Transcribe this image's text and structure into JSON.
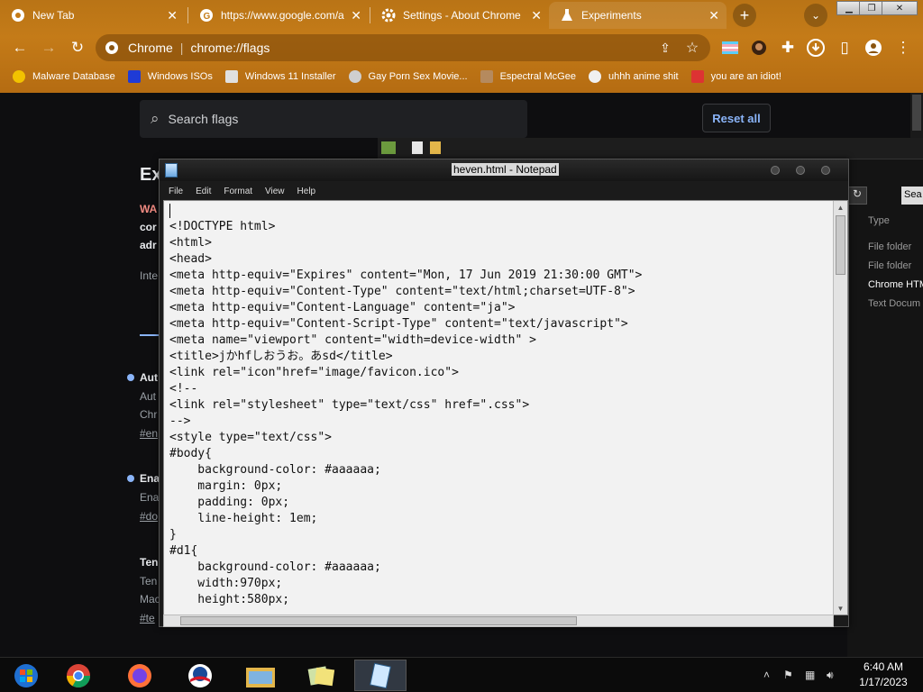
{
  "browser": {
    "tabs": [
      {
        "title": "New Tab",
        "icon": "chrome-icon"
      },
      {
        "title": "https://www.google.com/a",
        "icon": "google-icon"
      },
      {
        "title": "Settings - About Chrome",
        "icon": "gear-icon"
      },
      {
        "title": "Experiments",
        "icon": "flask-icon"
      }
    ],
    "address": {
      "site": "Chrome",
      "url": "chrome://flags"
    },
    "bookmarks": [
      {
        "label": "Malware Database",
        "color": "#f2c200"
      },
      {
        "label": "Windows ISOs",
        "color": "#1f3bd6"
      },
      {
        "label": "Windows 11 Installer",
        "color": "#e0e0e0"
      },
      {
        "label": "Gay Porn Sex Movie...",
        "color": "#cfcfcf"
      },
      {
        "label": "Espectral McGee",
        "color": "#b58a5e"
      },
      {
        "label": "uhhh anime shit",
        "color": "#f0f0f0"
      },
      {
        "label": "you are an idiot!",
        "color": "#d33"
      }
    ]
  },
  "flags": {
    "search_placeholder": "Search flags",
    "reset_label": "Reset all",
    "peek": {
      "title": "Ex",
      "warn": "WA",
      "line2": "cor",
      "line3": "adr",
      "line4": "Inte",
      "item1_head": "Aut",
      "item1_a": "Aut",
      "item1_b": "Chr",
      "item1_c": "#en",
      "item2_head": "Ena",
      "item2_a": "Ena",
      "item2_b": "#do",
      "item3_head": "Ten",
      "item3_a": "Ten",
      "item3_b": "Mac",
      "item3_c": "#te"
    }
  },
  "explorer": {
    "search_label": "Sea",
    "column": "Type",
    "rows": [
      "File folder",
      "File folder",
      "Chrome HTM",
      "Text Docum"
    ]
  },
  "notepad": {
    "title": "heven.html - Notepad",
    "menu": [
      "File",
      "Edit",
      "Format",
      "View",
      "Help"
    ],
    "content": "<!DOCTYPE html>\n<html>\n<head>\n<meta http-equiv=\"Expires\" content=\"Mon, 17 Jun 2019 21:30:00 GMT\">\n<meta http-equiv=\"Content-Type\" content=\"text/html;charset=UTF-8\">\n<meta http-equiv=\"Content-Language\" content=\"ja\">\n<meta http-equiv=\"Content-Script-Type\" content=\"text/javascript\">\n<meta name=\"viewport\" content=\"width=device-width\" >\n<title>jかhfしおうお。あsd</title>\n<link rel=\"icon\"href=\"image/favicon.ico\">\n<!--\n<link rel=\"stylesheet\" type=\"text/css\" href=\".css\">\n-->\n<style type=\"text/css\">\n#body{\n    background-color: #aaaaaa;\n    margin: 0px;\n    padding: 0px;\n    line-height: 1em;\n}\n#d1{\n    background-color: #aaaaaa;\n    width:970px;\n    height:580px;"
  },
  "taskbar": {
    "apps": [
      "windows-start-icon",
      "chrome-icon",
      "firefox-icon",
      "obama-logo-icon",
      "file-explorer-icon",
      "sticky-notes-icon",
      "notepad-icon"
    ],
    "time": "6:40 AM",
    "date": "1/17/2023"
  }
}
